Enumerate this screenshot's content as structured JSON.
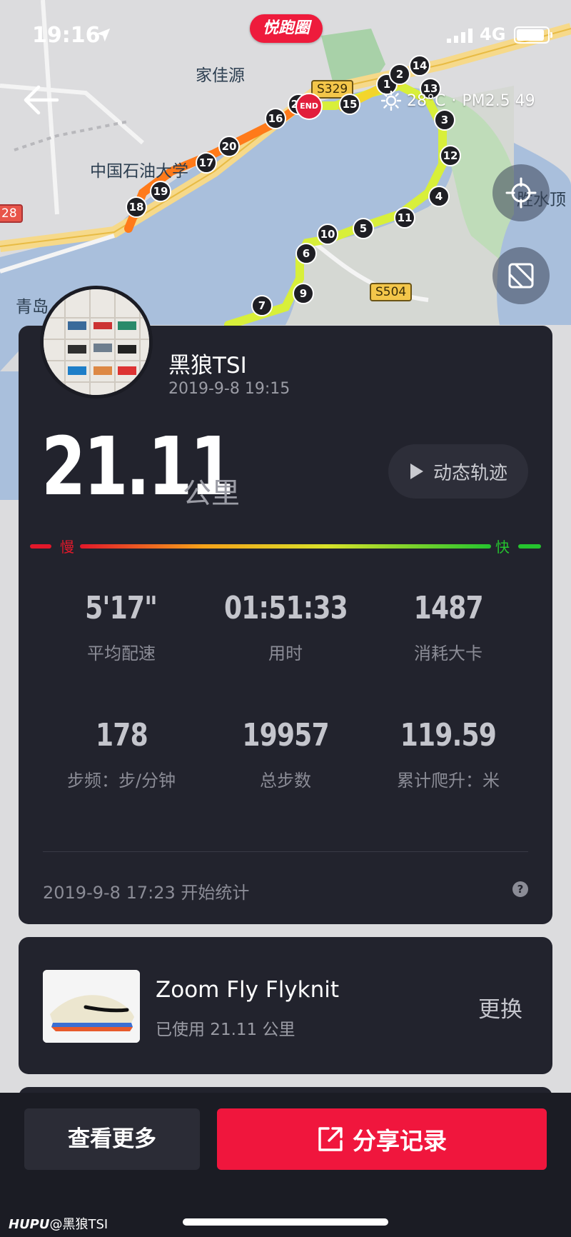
{
  "status_bar": {
    "time": "19:16",
    "network": "4G",
    "app_badge": "悦跑圈"
  },
  "map": {
    "labels": [
      {
        "id": "jiajiayuan",
        "text": "家佳源"
      },
      {
        "id": "shiyou",
        "text": "中国石油大学"
      },
      {
        "id": "qingdao",
        "text": "青岛"
      },
      {
        "id": "shengshuiding",
        "text": "胜水顶"
      }
    ],
    "road_tags": {
      "s329": "S329",
      "s504": "S504",
      "r28": "28"
    },
    "end_marker": "END",
    "km_markers": [
      "1",
      "2",
      "3",
      "4",
      "5",
      "6",
      "7",
      "9",
      "10",
      "11",
      "12",
      "13",
      "14",
      "15",
      "16",
      "17",
      "18",
      "19",
      "20",
      "21"
    ]
  },
  "weather": {
    "temperature": "28°C",
    "air": "PM2.5 49"
  },
  "profile": {
    "username": "黑狼TSI",
    "datetime": "2019-9-8 19:15"
  },
  "run": {
    "distance": "21.11",
    "unit": "公里",
    "track_label": "动态轨迹",
    "speed_scale": {
      "slow": "慢",
      "fast": "快"
    }
  },
  "stats": [
    {
      "value": "5'17\"",
      "label": "平均配速"
    },
    {
      "value": "01:51:33",
      "label": "用时"
    },
    {
      "value": "1487",
      "label": "消耗大卡"
    },
    {
      "value": "178",
      "label": "步频：步/分钟"
    },
    {
      "value": "19957",
      "label": "总步数"
    },
    {
      "value": "119.59",
      "label": "累计爬升：米"
    }
  ],
  "start_info": "2019-9-8 17:23 开始统计",
  "help_label": "?",
  "shoe": {
    "name": "Zoom Fly Flyknit",
    "usage": "已使用 21.11 公里",
    "replace_label": "更换"
  },
  "actions": {
    "more_label": "查看更多",
    "share_label": "分享记录"
  },
  "watermark": {
    "brand": "HUPU",
    "user": "@黑狼TSI"
  }
}
